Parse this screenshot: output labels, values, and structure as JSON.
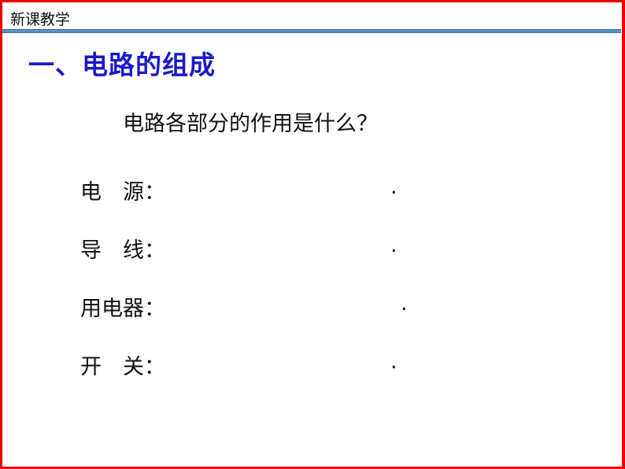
{
  "header": {
    "section_label": "新课教学",
    "border_color": "#ee0000",
    "rule_color": "#5b8fc9"
  },
  "title": "一、电路的组成",
  "title_color": "#1a1ac8",
  "question": "电路各部分的作用是什么？",
  "items": [
    {
      "label": "电　源：",
      "blank_end": "."
    },
    {
      "label": "导　线：",
      "blank_end": "."
    },
    {
      "label": "用电器：",
      "blank_end": "."
    },
    {
      "label": "开　关：",
      "blank_end": "."
    }
  ]
}
